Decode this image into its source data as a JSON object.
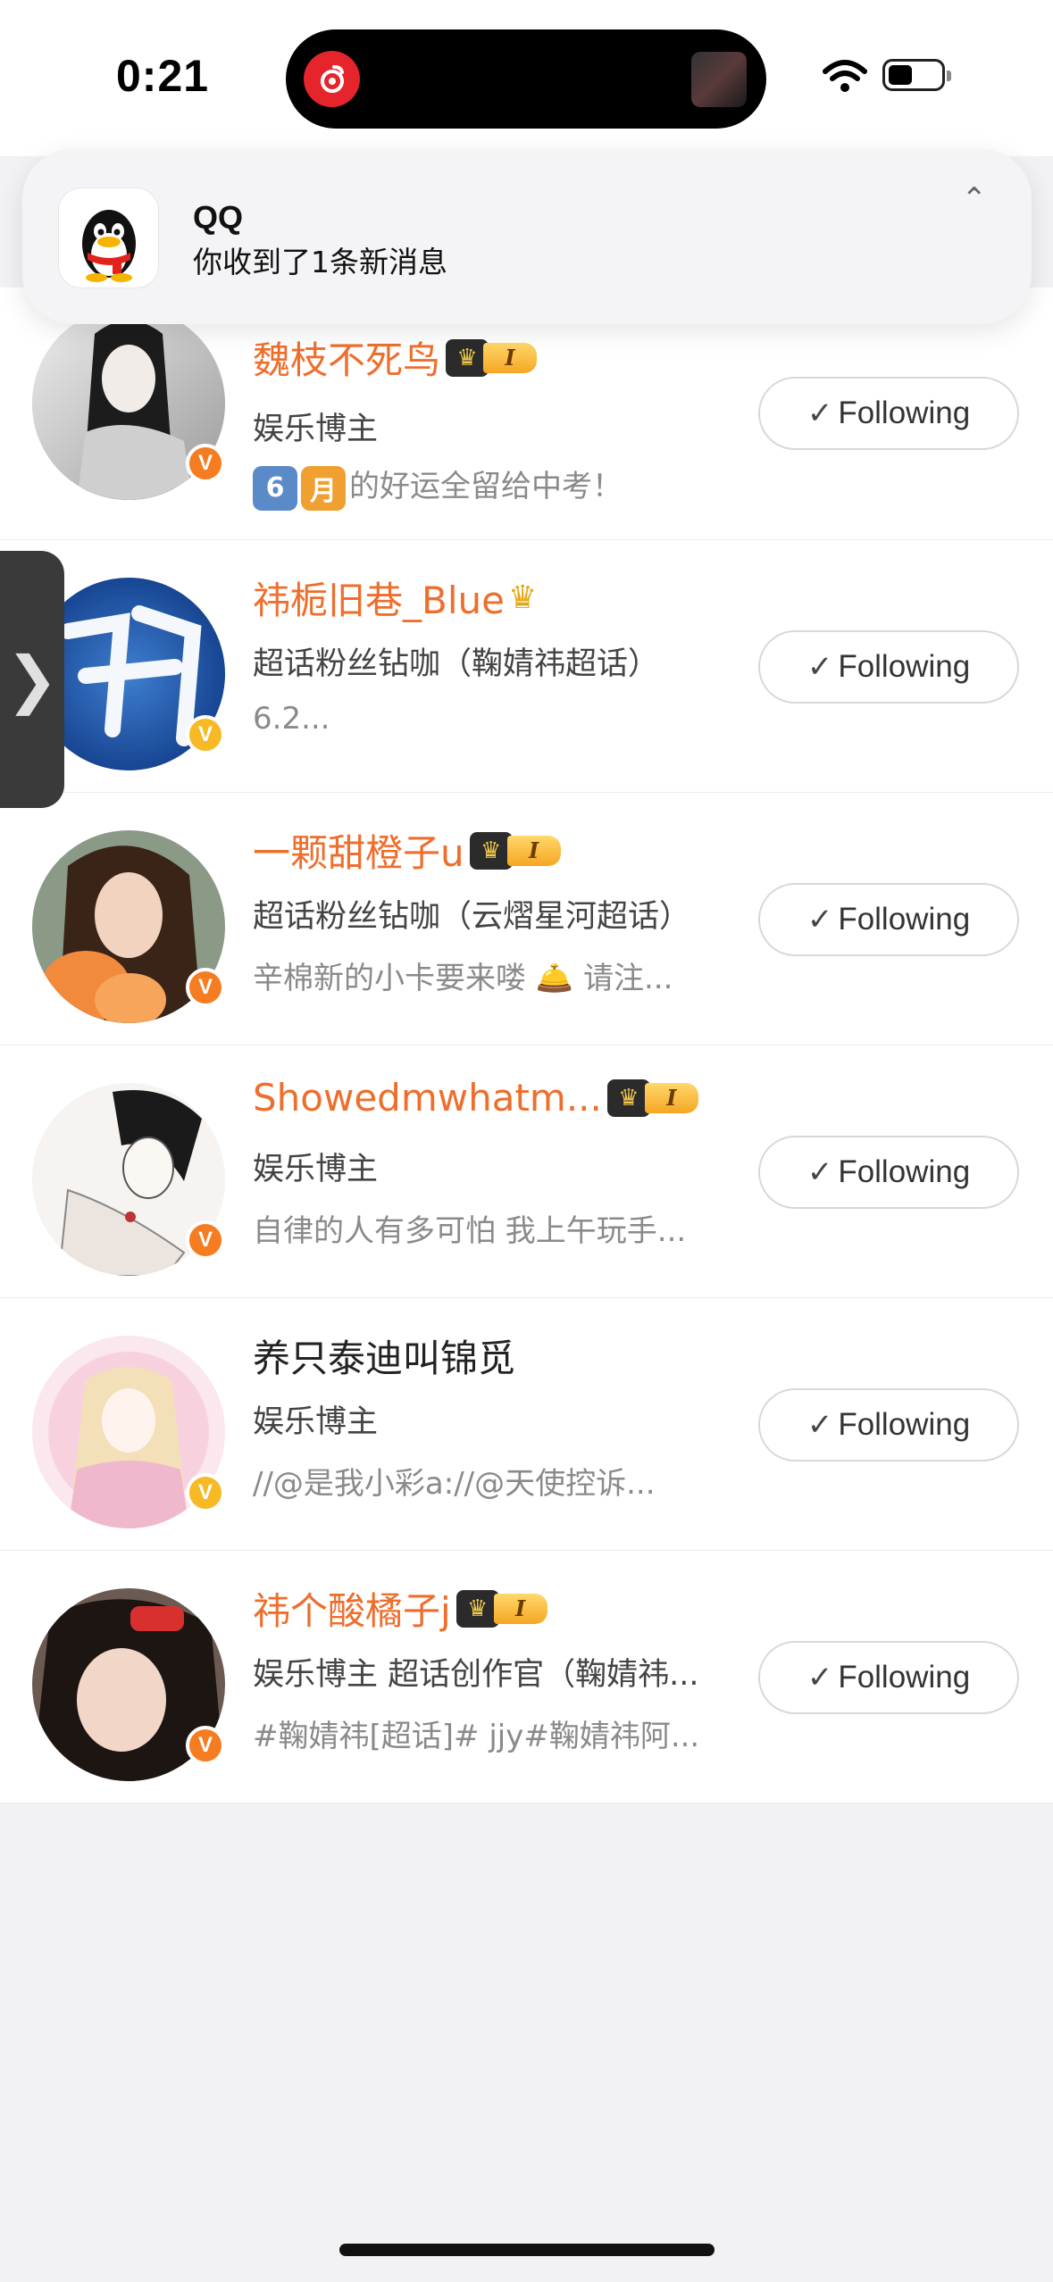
{
  "status": {
    "time": "0:21"
  },
  "notification": {
    "app": "QQ",
    "message": "你收到了1条新消息",
    "chevron": "⌃"
  },
  "users": [
    {
      "name": "魏枝不死鸟",
      "vip_level": "I",
      "desc": "娱乐博主",
      "sub_prefix": [
        "6",
        "月"
      ],
      "sub": "的好运全留给中考！",
      "badge": "orange",
      "name_style": "orange",
      "button": "Following"
    },
    {
      "name": "祎栀旧巷_Blue",
      "vip_level": "",
      "desc": "超话粉丝钻咖（鞠婧祎超话）",
      "sub": "6.2...",
      "badge": "gold",
      "name_style": "orange",
      "button": "Following"
    },
    {
      "name": "一颗甜橙子u",
      "vip_level": "I",
      "desc": "超话粉丝钻咖（云熠星河超话）",
      "sub": "辛棉新的小卡要来喽 🛎️ 请注...",
      "badge": "orange",
      "name_style": "orange",
      "button": "Following"
    },
    {
      "name": "Showedmwhatm...",
      "vip_level": "I",
      "desc": "娱乐博主",
      "sub": "自律的人有多可怕 我上午玩手...",
      "badge": "orange",
      "name_style": "orange",
      "button": "Following"
    },
    {
      "name": "养只泰迪叫锦觅",
      "vip_level": "",
      "desc": "娱乐博主",
      "sub": "//@是我小彩a://@天使控诉...",
      "badge": "gold",
      "name_style": "plain",
      "button": "Following"
    },
    {
      "name": "祎个酸橘子j",
      "vip_level": "I",
      "desc": "娱乐博主 超话创作官（鞠婧祎...",
      "sub": "#鞠婧祎[超话]# jjy#鞠婧祎阿...",
      "badge": "orange",
      "name_style": "orange",
      "button": "Following"
    }
  ],
  "badge_letter": "V",
  "icons": {
    "check": "✓",
    "sidetab": "❯"
  },
  "colors": {
    "accent": "#ee6e2c",
    "badge_orange": "#f57c21",
    "badge_gold": "#f7b924"
  }
}
